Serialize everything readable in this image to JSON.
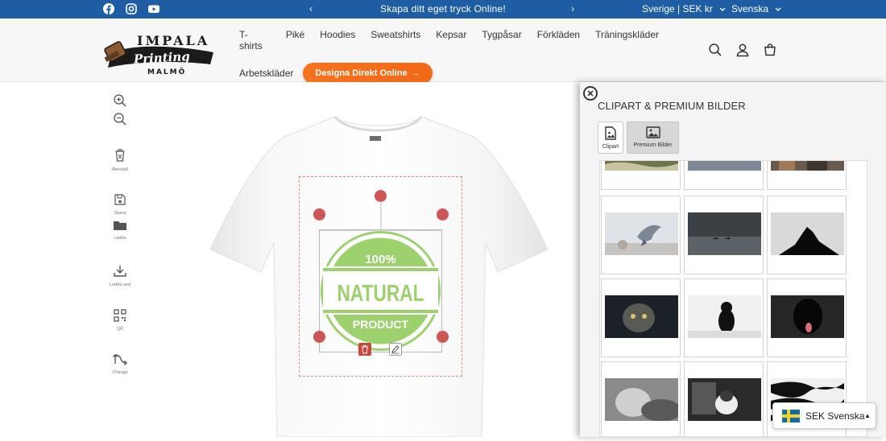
{
  "announcement": {
    "text": "Skapa ditt eget tryck Online!",
    "prev": "‹",
    "next": "›",
    "country_currency": "Sverige | SEK kr",
    "language": "Svenska"
  },
  "header": {
    "logo": {
      "line1": "IMPALA",
      "line2": "Printing",
      "line3": "MALMÖ"
    },
    "nav": [
      "T-shirts",
      "Piké",
      "Hoodies",
      "Sweatshirts",
      "Kepsar",
      "Tygpåsar",
      "Förkläden",
      "Träningskläder",
      "Arbetskläder"
    ],
    "cta_label": "Designa Direkt Online",
    "cta_arrow": "→"
  },
  "tools": [
    {
      "name": "zoom-in",
      "label": ""
    },
    {
      "name": "zoom-out",
      "label": ""
    },
    {
      "name": "reset",
      "label": "Återställ"
    },
    {
      "name": "save",
      "label": "Spara"
    },
    {
      "name": "load",
      "label": "Ladda"
    },
    {
      "name": "download",
      "label": "Ladda ned"
    },
    {
      "name": "qr",
      "label": "QR"
    },
    {
      "name": "change",
      "label": "Change"
    }
  ],
  "design": {
    "top": "100%",
    "middle": "NATURAL",
    "bottom": "PRODUCT",
    "color": "#9cd16d"
  },
  "panel": {
    "title": "CLIPART & PREMIUM BILDER",
    "tabs": [
      {
        "label": "Clipart",
        "active": false
      },
      {
        "label": "Premium Bilder",
        "active": true
      }
    ],
    "images": [
      "landscape-1",
      "sky-2",
      "people-3",
      "pigeon",
      "lake-birds",
      "silhouette",
      "cat-dark",
      "black-cat-snow",
      "black-dog",
      "cat-bw",
      "cat-window",
      "zebra"
    ]
  },
  "language_widget": {
    "label": "SEK Svenska",
    "caret": "▲"
  },
  "colors": {
    "topbar": "#1e5da3",
    "cta": "#f7731c",
    "handle": "#cf5656"
  }
}
